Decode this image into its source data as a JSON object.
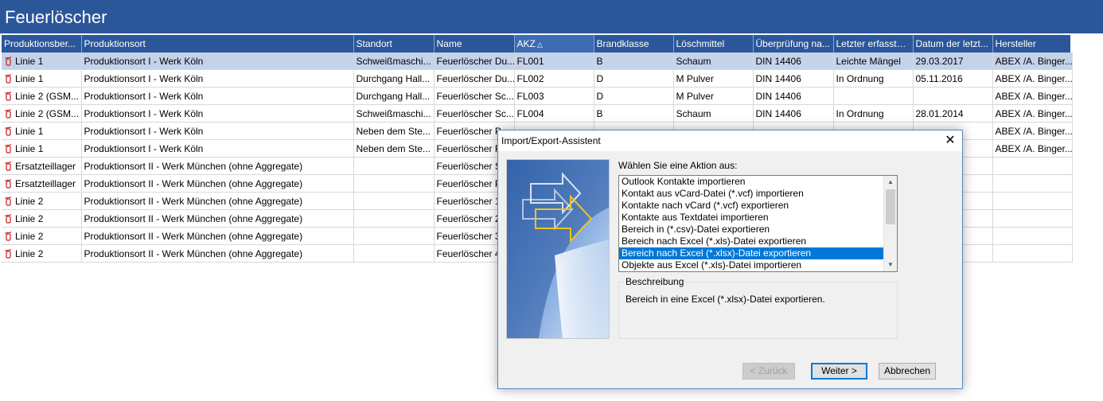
{
  "app": {
    "title": "Feuerlöscher"
  },
  "grid": {
    "columns": [
      {
        "label": "Produktionsber..."
      },
      {
        "label": "Produktionsort"
      },
      {
        "label": "Standort"
      },
      {
        "label": "Name"
      },
      {
        "label": "AKZ",
        "sorted": true
      },
      {
        "label": "Brandklasse"
      },
      {
        "label": "Löschmittel"
      },
      {
        "label": "Überprüfung na..."
      },
      {
        "label": "Letzter erfasster..."
      },
      {
        "label": "Datum der letzt..."
      },
      {
        "label": "Hersteller"
      }
    ],
    "sort_icon": "sort-ascending-icon",
    "row_icon": "fire-extinguisher-icon",
    "rows": [
      {
        "cells": [
          "Linie 1",
          "Produktionsort I - Werk Köln",
          "Schweißmaschi...",
          "Feuerlöscher Du...",
          "FL001",
          "B",
          "Schaum",
          "DIN 14406",
          "Leichte Mängel",
          "29.03.2017",
          "ABEX /A. Binger..."
        ],
        "selected": true
      },
      {
        "cells": [
          "Linie 1",
          "Produktionsort I - Werk Köln",
          "Durchgang Hall...",
          "Feuerlöscher Du...",
          "FL002",
          "D",
          "M Pulver",
          "DIN 14406",
          "In Ordnung",
          "05.11.2016",
          "ABEX /A. Binger..."
        ]
      },
      {
        "cells": [
          "Linie 2 (GSM...",
          "Produktionsort I - Werk Köln",
          "Durchgang Hall...",
          "Feuerlöscher Sc...",
          "FL003",
          "D",
          "M Pulver",
          "DIN 14406",
          "",
          "",
          "ABEX /A. Binger..."
        ]
      },
      {
        "cells": [
          "Linie 2 (GSM...",
          "Produktionsort I - Werk Köln",
          "Schweißmaschi...",
          "Feuerlöscher Sc...",
          "FL004",
          "B",
          "Schaum",
          "DIN 14406",
          "In Ordnung",
          "28.01.2014",
          "ABEX /A. Binger..."
        ]
      },
      {
        "cells": [
          "Linie 1",
          "Produktionsort I - Werk Köln",
          "Neben dem Ste...",
          "Feuerlöscher P",
          "",
          "",
          "",
          "",
          "",
          "",
          "ABEX /A. Binger..."
        ]
      },
      {
        "cells": [
          "Linie 1",
          "Produktionsort I - Werk Köln",
          "Neben dem Ste...",
          "Feuerlöscher P",
          "",
          "",
          "",
          "",
          "",
          "",
          "ABEX /A. Binger..."
        ]
      },
      {
        "cells": [
          "Ersatzteillager",
          "Produktionsort II - Werk München (ohne Aggregate)",
          "",
          "Feuerlöscher S",
          "",
          "",
          "",
          "",
          "",
          "",
          ""
        ]
      },
      {
        "cells": [
          "Ersatzteillager",
          "Produktionsort II - Werk München (ohne Aggregate)",
          "",
          "Feuerlöscher P",
          "",
          "",
          "",
          "",
          "",
          "",
          ""
        ]
      },
      {
        "cells": [
          "Linie 2",
          "Produktionsort II - Werk München (ohne Aggregate)",
          "",
          "Feuerlöscher 1",
          "",
          "",
          "",
          "",
          "",
          "",
          ""
        ]
      },
      {
        "cells": [
          "Linie 2",
          "Produktionsort II - Werk München (ohne Aggregate)",
          "",
          "Feuerlöscher 2",
          "",
          "",
          "",
          "",
          "",
          "",
          ""
        ]
      },
      {
        "cells": [
          "Linie 2",
          "Produktionsort II - Werk München (ohne Aggregate)",
          "",
          "Feuerlöscher 3",
          "",
          "",
          "",
          "",
          "",
          "",
          ""
        ]
      },
      {
        "cells": [
          "Linie 2",
          "Produktionsort II - Werk München (ohne Aggregate)",
          "",
          "Feuerlöscher 4",
          "",
          "",
          "",
          "",
          "",
          "",
          ""
        ]
      }
    ]
  },
  "dialog": {
    "title": "Import/Export-Assistent",
    "close_icon": "close-icon",
    "prompt": "Wählen Sie eine Aktion aus:",
    "actions": [
      "Outlook Kontakte importieren",
      "Kontakt aus vCard-Datei (*.vcf) importieren",
      "Kontakte nach vCard (*.vcf) exportieren",
      "Kontakte aus Textdatei importieren",
      "Bereich in (*.csv)-Datei exportieren",
      "Bereich nach Excel (*.xls)-Datei exportieren",
      "Bereich nach Excel (*.xlsx)-Datei exportieren",
      "Objekte aus Excel (*.xls)-Datei importieren"
    ],
    "selected_action_index": 6,
    "description_label": "Beschreibung",
    "description_text": "Bereich in eine Excel (*.xlsx)-Datei exportieren.",
    "buttons": {
      "back": "< Zurück",
      "next": "Weiter >",
      "cancel": "Abbrechen"
    }
  },
  "colors": {
    "header_blue": "#2b579a",
    "selection_blue": "#0078d7",
    "row_selected": "#c5d3ea"
  }
}
